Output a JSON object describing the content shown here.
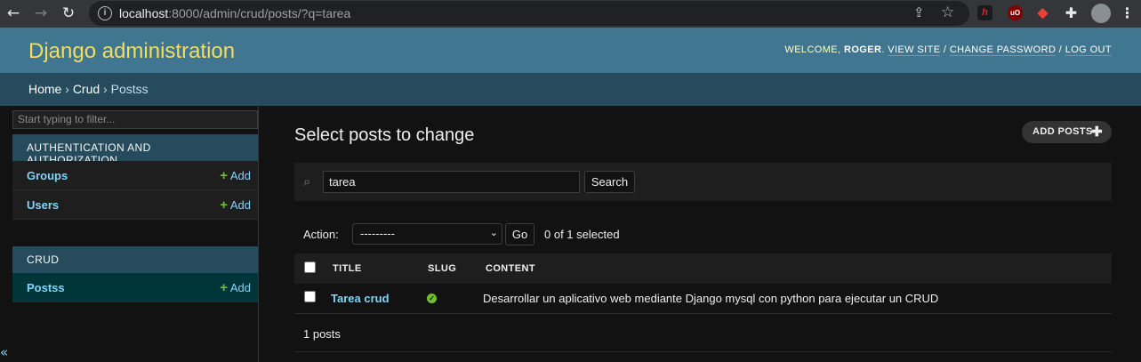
{
  "browser": {
    "url_host": "localhost",
    "url_rest": ":8000/admin/crud/posts/?q=tarea",
    "icons": [
      "back-icon",
      "forward-icon",
      "reload-icon",
      "info-icon",
      "share-icon",
      "star-icon",
      "extension-h-icon",
      "ublock-icon",
      "pdf-icon",
      "puzzle-icon",
      "profile-avatar",
      "menu-icon"
    ],
    "ext_h": "h",
    "ext_ub": "uO"
  },
  "header": {
    "brand": "Django administration",
    "welcome": "WELCOME, ",
    "user": "ROGER",
    "view_site": "VIEW SITE",
    "change_password": "CHANGE PASSWORD",
    "log_out": "LOG OUT",
    "separator": " / "
  },
  "breadcrumbs": {
    "home": "Home",
    "app": "Crud",
    "model": "Postss",
    "sep": " › "
  },
  "sidebar": {
    "filter_placeholder": "Start typing to filter...",
    "modules": [
      {
        "caption": "AUTHENTICATION AND AUTHORIZATION",
        "items": [
          {
            "name": "Groups",
            "add": "Add"
          },
          {
            "name": "Users",
            "add": "Add"
          }
        ]
      },
      {
        "caption": "CRUD",
        "items": [
          {
            "name": "Postss",
            "add": "Add"
          }
        ]
      }
    ],
    "collapse": "«"
  },
  "main": {
    "title": "Select posts to change",
    "add_button": "ADD POSTS",
    "search": {
      "value": "tarea",
      "button": "Search"
    },
    "actions": {
      "label": "Action:",
      "selected": "---------",
      "go": "Go",
      "count": "0 of 1 selected"
    },
    "columns": [
      "TITLE",
      "SLUG",
      "CONTENT"
    ],
    "rows": [
      {
        "title": "Tarea crud",
        "slug_status": "true",
        "content": "Desarrollar un aplicativo web mediante Django mysql con python para ejecutar un CRUD"
      }
    ],
    "paginator": "1 posts"
  },
  "colors": {
    "header": "#417690",
    "brand": "#f5dd5d",
    "breadcrumbs": "#264b5d",
    "link": "#81d4fa",
    "add_green": "#70bf2b",
    "background": "#121212"
  }
}
